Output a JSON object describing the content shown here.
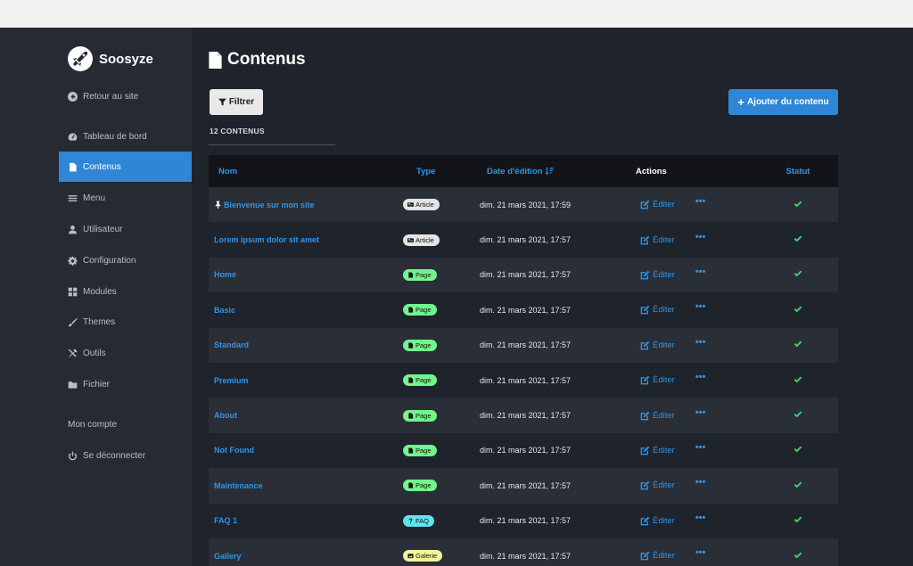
{
  "app": {
    "name": "Soosyze"
  },
  "sidebar": {
    "items": [
      {
        "label": "Retour au site",
        "icon": "arrow-circle-left-icon"
      },
      {
        "label": "Tableau de bord",
        "icon": "dashboard-icon"
      },
      {
        "label": "Contenus",
        "icon": "file-icon",
        "active": true
      },
      {
        "label": "Menu",
        "icon": "bars-icon"
      },
      {
        "label": "Utilisateur",
        "icon": "user-icon"
      },
      {
        "label": "Configuration",
        "icon": "cog-icon"
      },
      {
        "label": "Modules",
        "icon": "th-large-icon"
      },
      {
        "label": "Themes",
        "icon": "paint-brush-icon"
      },
      {
        "label": "Outils",
        "icon": "tools-icon"
      },
      {
        "label": "Fichier",
        "icon": "folder-icon"
      },
      {
        "label": "Mon compte",
        "icon": ""
      },
      {
        "label": "Se déconnecter",
        "icon": "power-icon"
      }
    ]
  },
  "main": {
    "title": "Contenus",
    "filter_label": "Filtrer",
    "add_label": "Ajouter du contenu",
    "count_label": "12 CONTENUS"
  },
  "table": {
    "headers": {
      "name": "Nom",
      "type": "Type",
      "date": "Date d'édition",
      "actions": "Actions",
      "status": "Statut"
    },
    "edit_label": "Éditer",
    "more_label": "•••",
    "rows": [
      {
        "name": "Bienvenue sur mon site",
        "pinned": true,
        "type": "Article",
        "date": "dim. 21 mars 2021, 17:59"
      },
      {
        "name": "Lorem ipsum dolor sit amet",
        "type": "Article",
        "date": "dim. 21 mars 2021, 17:57"
      },
      {
        "name": "Home",
        "type": "Page",
        "date": "dim. 21 mars 2021, 17:57"
      },
      {
        "name": "Basic",
        "type": "Page",
        "date": "dim. 21 mars 2021, 17:57"
      },
      {
        "name": "Standard",
        "type": "Page",
        "date": "dim. 21 mars 2021, 17:57"
      },
      {
        "name": "Premium",
        "type": "Page",
        "date": "dim. 21 mars 2021, 17:57"
      },
      {
        "name": "About",
        "type": "Page",
        "date": "dim. 21 mars 2021, 17:57"
      },
      {
        "name": "Not Found",
        "type": "Page",
        "date": "dim. 21 mars 2021, 17:57"
      },
      {
        "name": "Maintenance",
        "type": "Page",
        "date": "dim. 21 mars 2021, 17:57"
      },
      {
        "name": "FAQ 1",
        "type": "FAQ",
        "date": "dim. 21 mars 2021, 17:57"
      },
      {
        "name": "Gallery",
        "type": "Galerie",
        "date": "dim. 21 mars 2021, 17:57"
      }
    ]
  },
  "colors": {
    "accent": "#2f86d6",
    "link": "#2f95e6",
    "badge_article": "#e4e4e4",
    "badge_page": "#72f58c",
    "badge_faq": "#5fe3f0",
    "badge_galerie": "#f4f29a",
    "status_ok": "#3fcf6b"
  }
}
